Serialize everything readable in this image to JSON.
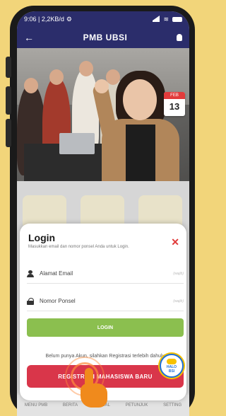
{
  "status_bar": {
    "time_speed": "9:06 | 2,2KB/d",
    "battery": "25"
  },
  "app_bar": {
    "brand": "PMB UBSI"
  },
  "hero": {
    "date_month": "FEB",
    "date_day": "13"
  },
  "login": {
    "title": "Login",
    "subtitle": "Masukkan email dan nomor ponsel Anda untuk Login.",
    "email_placeholder": "Alamat Email",
    "phone_placeholder": "Nomor Ponsel",
    "required_hint": "(wajib)",
    "login_button": "LOGIN",
    "register_prompt": "Belum punya Akun, silahkan Registrasi terlebih dahulu",
    "register_button": "REGISTRASI MAHASISWA BARU"
  },
  "halo_badge": {
    "line1": "HALO",
    "line2": "BSI"
  },
  "bottom_nav": {
    "items": [
      "MENU PMB",
      "BERITA",
      "JADWAL",
      "PETUNJUK",
      "SETTING"
    ]
  }
}
